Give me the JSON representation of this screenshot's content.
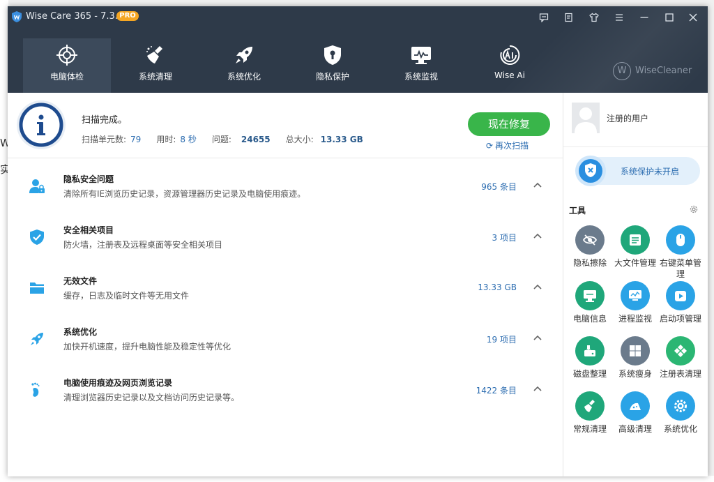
{
  "window": {
    "title": "Wise Care 365 - 7.3.5",
    "badge": "PRO"
  },
  "background": {
    "letters": [
      "W",
      "实"
    ]
  },
  "titlebar_buttons": [
    "feedback-icon",
    "notes-icon",
    "skin-icon",
    "menu-icon",
    "minimize-icon",
    "maximize-icon",
    "close-icon"
  ],
  "nav": [
    {
      "label": "电脑体检",
      "icon": "crosshair-icon",
      "active": true
    },
    {
      "label": "系统清理",
      "icon": "broom-icon",
      "active": false
    },
    {
      "label": "系统优化",
      "icon": "rocket-icon",
      "active": false
    },
    {
      "label": "隐私保护",
      "icon": "shield-lock-icon",
      "active": false
    },
    {
      "label": "系统监视",
      "icon": "monitor-icon",
      "active": false
    },
    {
      "label": "Wise Ai",
      "icon": "ai-icon",
      "active": false
    }
  ],
  "brand": {
    "mark": "W",
    "name": "WiseCleaner"
  },
  "summary": {
    "title": "扫描完成。",
    "units_label": "扫描单元数:",
    "units_value": "79",
    "time_label": "用时:",
    "time_value": "8 秒",
    "issues_label": "问题:",
    "issues_value": "24655",
    "size_label": "总大小:",
    "size_value": "13.33 GB",
    "fix_button": "现在修复",
    "rescan": "再次扫描"
  },
  "categories": [
    {
      "title": "隐私安全问题",
      "desc": "清除所有IE浏览历史记录，资源管理器历史记录及电脑使用痕迹。",
      "count": "965 条目",
      "icon": "user-lock-icon"
    },
    {
      "title": "安全相关项目",
      "desc": "防火墙，注册表及远程桌面等安全相关项目",
      "count": "3 项目",
      "icon": "shield-check-icon"
    },
    {
      "title": "无效文件",
      "desc": "缓存，日志及临时文件等无用文件",
      "count": "13.33 GB",
      "icon": "folder-icon"
    },
    {
      "title": "系统优化",
      "desc": "加快开机速度，提升电脑性能及稳定性等优化",
      "count": "19 项目",
      "icon": "rocket-icon"
    },
    {
      "title": "电脑使用痕迹及网页浏览记录",
      "desc": "清理浏览器历史记录以及文档访问历史记录等。",
      "count": "1422 条目",
      "icon": "footprint-icon"
    }
  ],
  "side": {
    "user_label": "注册的用户",
    "protection_label": "系统保护未开启",
    "tools_title": "工具"
  },
  "tools": [
    {
      "label": "隐私擦除",
      "icon": "eye-slash-icon",
      "color": "#6b7b8c"
    },
    {
      "label": "大文件管理",
      "icon": "file-list-icon",
      "color": "#1fa77a"
    },
    {
      "label": "右键菜单管理",
      "icon": "mouse-icon",
      "color": "#2aa3e6"
    },
    {
      "label": "电脑信息",
      "icon": "computer-icon",
      "color": "#1fa77a"
    },
    {
      "label": "进程监视",
      "icon": "monitor-chart-icon",
      "color": "#2aa3e6"
    },
    {
      "label": "启动项管理",
      "icon": "play-icon",
      "color": "#2aa3e6"
    },
    {
      "label": "磁盘整理",
      "icon": "disk-icon",
      "color": "#1fa77a"
    },
    {
      "label": "系统瘦身",
      "icon": "windows-icon",
      "color": "#6b7b8c"
    },
    {
      "label": "注册表清理",
      "icon": "registry-icon",
      "color": "#2bb673"
    },
    {
      "label": "常规清理",
      "icon": "broom-icon",
      "color": "#1fa77a"
    },
    {
      "label": "高级清理",
      "icon": "eraser-icon",
      "color": "#2aa3e6"
    },
    {
      "label": "系统优化",
      "icon": "gear-icon",
      "color": "#2aa3e6"
    }
  ],
  "colors": {
    "header": "#2e3a49",
    "nav_active": "#3c4a5b",
    "fix_button": "#39b54a",
    "accent_blue": "#2b6cb0",
    "pro_badge": "#f5a623"
  }
}
